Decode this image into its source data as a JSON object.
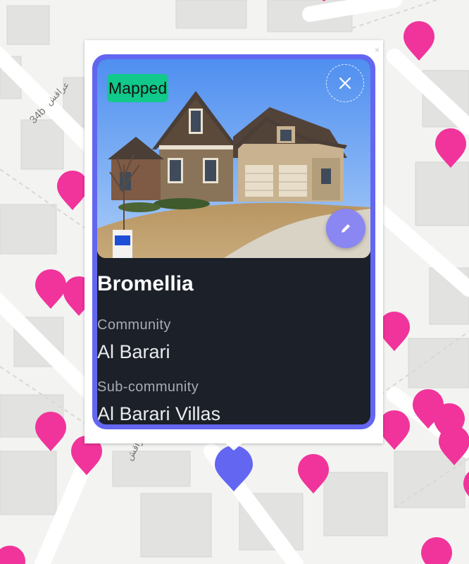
{
  "map": {
    "street_label_1": "34b",
    "street_label_1_arabic": "عراقش",
    "street_label_2_arabic": "عراقش",
    "marker_color": "#f0349b",
    "selected_marker_color": "#6366f1"
  },
  "popup": {
    "status_badge": "Mapped",
    "status_color": "#10c98a",
    "accent_color": "#6366f1",
    "close_icon": "close-icon",
    "edit_icon": "pencil-icon",
    "title": "Bromellia",
    "community_label": "Community",
    "community_value": "Al Barari",
    "subcommunity_label": "Sub-community",
    "subcommunity_value": "Al Barari Villas"
  }
}
